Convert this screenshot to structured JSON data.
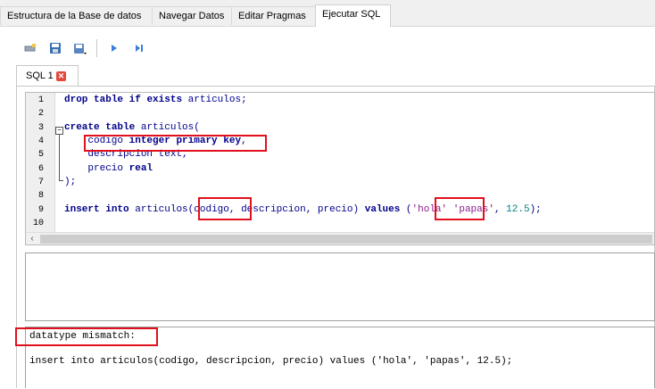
{
  "main_tabs": [
    {
      "label": "Estructura de la Base de datos"
    },
    {
      "label": "Navegar Datos"
    },
    {
      "label": "Editar Pragmas"
    },
    {
      "label": "Ejecutar SQL"
    }
  ],
  "active_main_tab": "Ejecutar SQL",
  "toolbar": {
    "icons": [
      "open-tab-icon",
      "open-sql-file-icon",
      "save-sql-file-icon",
      "execute-all-icon",
      "execute-line-icon"
    ]
  },
  "sql_tab": {
    "label": "SQL 1",
    "close_icon": "close-icon"
  },
  "editor": {
    "line_numbers": [
      "1",
      "2",
      "3",
      "4",
      "5",
      "6",
      "7",
      "8",
      "9",
      "10"
    ],
    "lines": [
      "drop table if exists articulos;",
      "",
      "create table articulos(",
      "    codigo integer primary key,",
      "    descripcion text,",
      "    precio real",
      ");",
      "",
      "insert into articulos(codigo, descripcion, precio) values ('hola' 'papas', 12.5);",
      ""
    ]
  },
  "message": {
    "error": "datatype mismatch:",
    "statement": "insert into articulos(codigo, descripcion, precio) values ('hola', 'papas', 12.5);"
  },
  "colors": {
    "highlight": "#e0101c",
    "keyword": "#00008b",
    "string": "#8b1a8b",
    "number": "#008080"
  }
}
